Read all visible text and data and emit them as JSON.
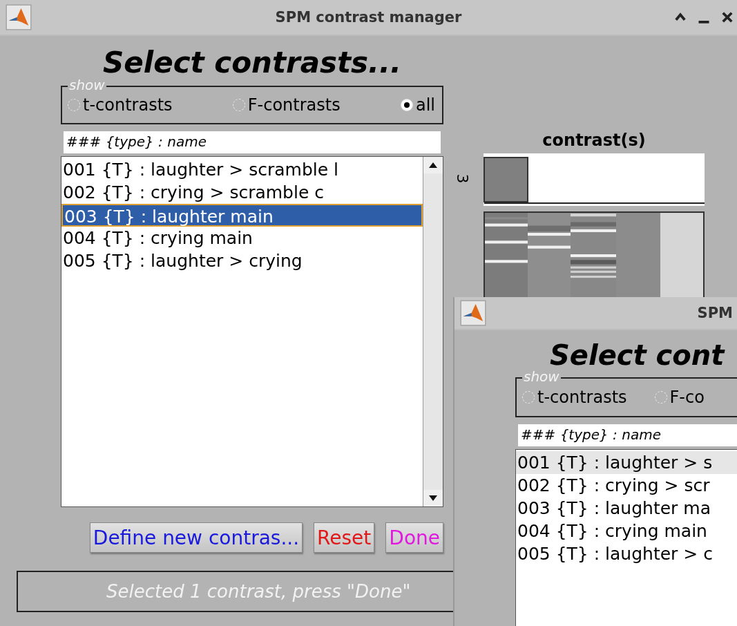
{
  "windows": [
    {
      "title": "SPM contrast manager",
      "heading": "Select contrasts...",
      "show_group": {
        "legend": "show",
        "options": [
          {
            "label": "t-contrasts",
            "selected": false
          },
          {
            "label": "F-contrasts",
            "selected": false
          },
          {
            "label": "all",
            "selected": true
          }
        ]
      },
      "list_header": "### {type} : name",
      "contrasts": [
        {
          "label": "001 {T} : laughter > scramble l",
          "selected": false
        },
        {
          "label": "002 {T} : crying > scramble c",
          "selected": false
        },
        {
          "label": "003 {T} : laughter main",
          "selected": true
        },
        {
          "label": "004 {T} : crying main",
          "selected": false
        },
        {
          "label": "005 {T} : laughter > crying",
          "selected": false
        }
      ],
      "design_panel": {
        "title": "contrast(s)",
        "axis_label": "3"
      },
      "buttons": [
        {
          "label": "Define new contras...",
          "color": "#1a1adc"
        },
        {
          "label": "Reset",
          "color": "#e01818"
        },
        {
          "label": "Done",
          "color": "#e018e0"
        }
      ],
      "status": "Selected 1 contrast, press \"Done\""
    },
    {
      "title": "SPM",
      "heading": "Select cont",
      "show_group": {
        "legend": "show",
        "options": [
          {
            "label": "t-contrasts",
            "selected": false
          },
          {
            "label": "F-co",
            "selected": false
          }
        ]
      },
      "list_header": "### {type} : name",
      "contrasts": [
        {
          "label": "001 {T} : laughter > s",
          "selected": true
        },
        {
          "label": "002 {T} : crying > scr",
          "selected": false
        },
        {
          "label": "003 {T} : laughter ma",
          "selected": false
        },
        {
          "label": "004 {T} : crying main",
          "selected": false
        },
        {
          "label": "005 {T} : laughter > c",
          "selected": false
        }
      ]
    }
  ]
}
